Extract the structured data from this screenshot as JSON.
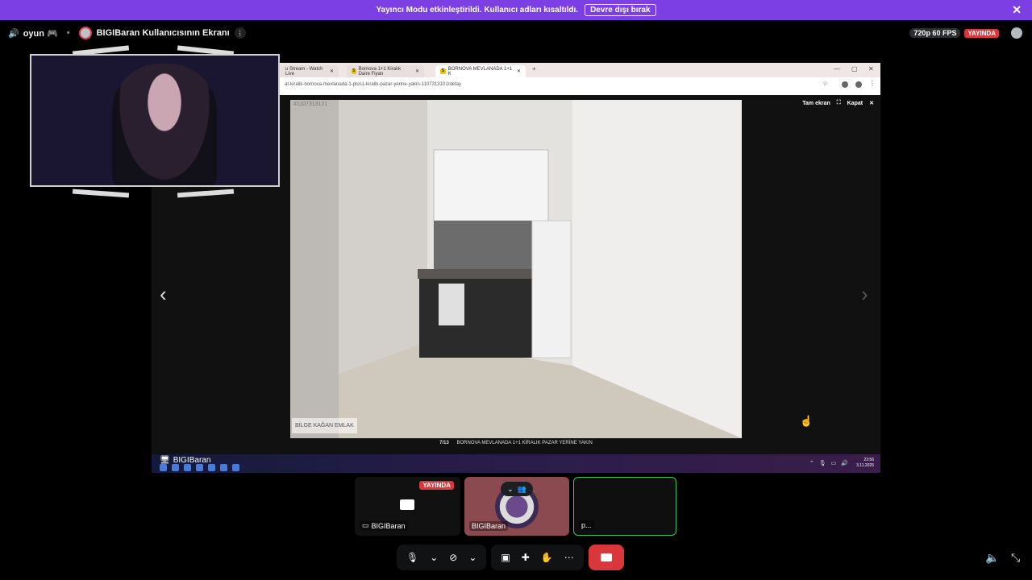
{
  "banner": {
    "text": "Yayıncı Modu etkinleştirildi. Kullanıcı adları kısaltıldı.",
    "button": "Devre dışı bırak",
    "close": "✕"
  },
  "topbar": {
    "channel": "oyun 🎮",
    "title": "BIGIBaran Kullanıcısının Ekranı",
    "quality": "720p 60 FPS",
    "live": "YAYINDA"
  },
  "browser": {
    "tabs": [
      {
        "label": "u Stream - Watch Live",
        "close": "✕"
      },
      {
        "label": "Bornova 1+1 Kiralık Daire Fiyatı",
        "close": "✕"
      },
      {
        "label": "BORNOVA MEVLANADA 1+1 K",
        "close": "✕"
      }
    ],
    "new_tab": "+",
    "win_controls": [
      "—",
      "▢",
      "✕"
    ],
    "url": "at-kiralik-bornova-mevlanada-1-plus1-kiralik-pazar-yerine-yakin-1107313101/detay"
  },
  "viewer": {
    "listing_id": "#1107313101",
    "fullscreen": "Tam ekran",
    "close": "Kapat",
    "watermark": "BİLGE KAĞAN EMLAK",
    "counter": "7/13",
    "caption": "BORNOVA MEVLANADA 1+1 KİRALIK PAZAR YERİNE YAKIN"
  },
  "taskbar": {
    "user": "BIGIBaran",
    "time": "23:56",
    "date": "3.11.2025"
  },
  "tiles": [
    {
      "name": "BIGIBaran",
      "live": "YAYINDA"
    },
    {
      "name": "BIGIBaran"
    },
    {
      "name": "p..."
    }
  ],
  "colors": {
    "banner": "#7b3fe4",
    "live": "#da373c",
    "end_call": "#da373c",
    "speaking": "#39c36b"
  }
}
